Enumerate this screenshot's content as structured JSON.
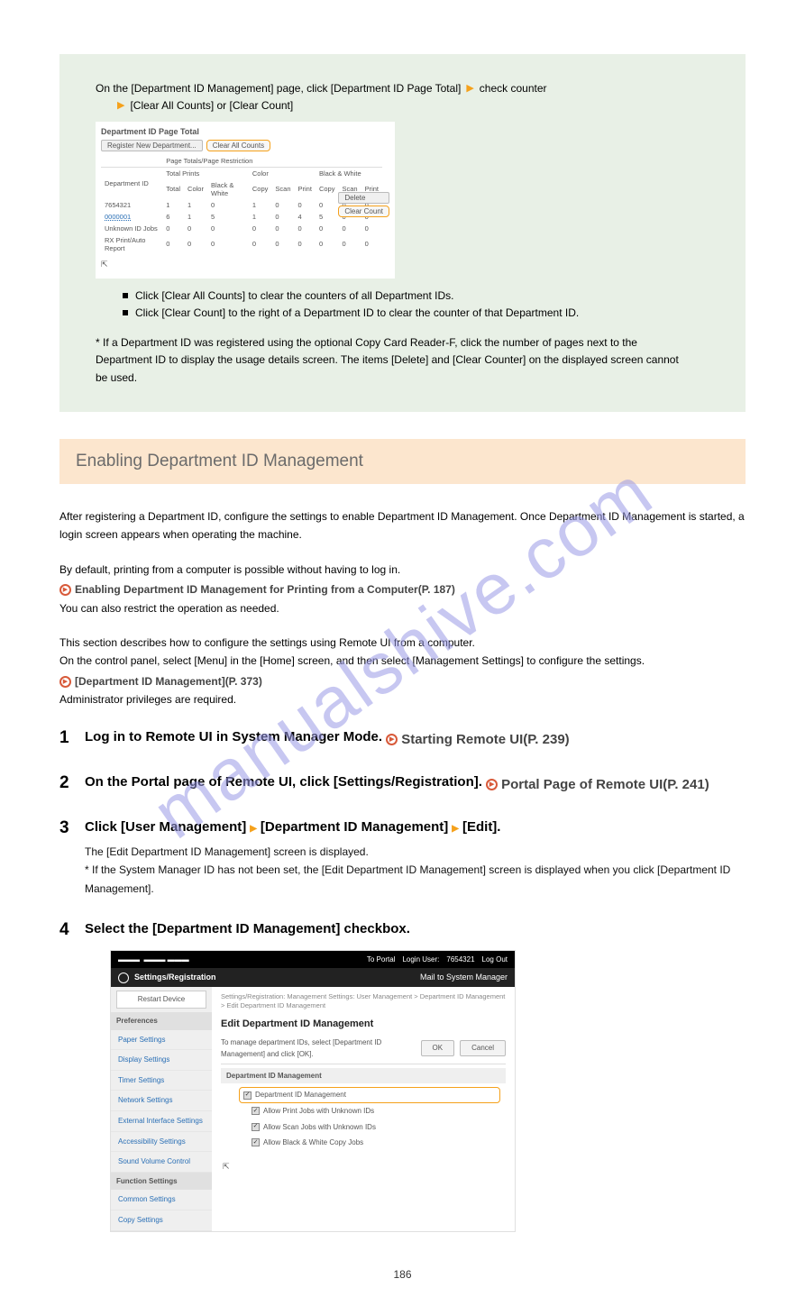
{
  "watermark": "manualshive.com",
  "green": {
    "line1_pre": "On the [Department ID Management] page, click [Department ID Page Total]",
    "line1_post": " check counter",
    "line2_pre": "",
    "line2_post": " [Clear All Counts] or [Clear Count]",
    "shot": {
      "title": "Department ID Page Total",
      "btn_register": "Register New Department...",
      "btn_clearall": "Clear All Counts",
      "hdr_pagetotals": "Page Totals/Page Restriction",
      "hdr_deptid": "Department ID",
      "hdr_totalprints": "Total Prints",
      "hdr_color": "Color",
      "hdr_bw": "Black & White",
      "sub_total": "Total",
      "sub_color": "Color",
      "sub_bw": "Black & White",
      "sub_copy": "Copy",
      "sub_scan": "Scan",
      "sub_print": "Print",
      "rows": [
        {
          "id": "7654321",
          "v": [
            "1",
            "1",
            "0",
            "1",
            "0",
            "0",
            "0",
            "0",
            "0"
          ]
        },
        {
          "id": "0000001",
          "v": [
            "6",
            "1",
            "5",
            "1",
            "0",
            "4",
            "5",
            "0",
            "0"
          ]
        },
        {
          "id": "Unknown ID Jobs",
          "v": [
            "0",
            "0",
            "0",
            "0",
            "0",
            "0",
            "0",
            "0",
            "0"
          ]
        },
        {
          "id": "RX Print/Auto Report",
          "v": [
            "0",
            "0",
            "0",
            "0",
            "0",
            "0",
            "0",
            "0",
            "0"
          ]
        }
      ],
      "btn_delete": "Delete",
      "btn_clearcount": "Clear Count"
    },
    "bullets": [
      "Click [Clear All Counts] to clear the counters of all Department IDs.",
      "Click [Clear Count] to the right of a Department ID to clear the counter of that Department ID."
    ],
    "note": "* If a Department ID was registered using the optional Copy Card Reader-F, click the number of pages next to the Department ID to display the usage details screen. The items [Delete] and [Clear Counter] on the displayed screen cannot be used."
  },
  "orange_title": "Enabling Department ID Management",
  "body": {
    "p1": "After registering a Department ID, configure the settings to enable Department ID Management. Once Department ID Management is started, a login screen appears when operating the machine.",
    "p2_pre": "By default, printing from a computer is possible without having to log in. ",
    "p2_link": "Enabling Department ID Management for Printing from a Computer(P. 187)",
    "p3": "You can also restrict the operation as needed.",
    "p4_pre": "This section describes how to configure the settings using Remote UI from a computer.",
    "p4_mid": "On the control panel, select [Menu] in the [Home] screen, and then select [Management Settings] to configure the settings. ",
    "p4_link": "[Department ID Management](P. 373)",
    "p5": "Administrator privileges are required."
  },
  "steps": [
    {
      "t": "Log in to Remote UI in System Manager Mode. ",
      "link": "Starting Remote UI(P. 239)"
    },
    {
      "t": "On the Portal page of Remote UI, click [Settings/Registration]. ",
      "link": "Portal Page of Remote UI(P. 241)"
    },
    {
      "t_html": "Click [User Management] {TRI} [Department ID Management] {TRI} [Edit].",
      "sub": "The [Edit Department ID Management] screen is displayed.",
      "note": "* If the System Manager ID has not been set, the [Edit Department ID Management] screen is displayed when you click [Department ID Management]."
    },
    {
      "t": "Select the [Department ID Management] checkbox."
    }
  ],
  "shot2": {
    "top_portal": "To Portal",
    "top_login": "Login User:",
    "top_user": "7654321",
    "top_logout": "Log Out",
    "sub_title": "Settings/Registration",
    "sub_mail": "Mail to System Manager",
    "restart": "Restart Device",
    "left_hdr1": "Preferences",
    "left_items1": [
      "Paper Settings",
      "Display Settings",
      "Timer Settings",
      "Network Settings",
      "External Interface Settings",
      "Accessibility Settings",
      "Sound Volume Control"
    ],
    "left_hdr2": "Function Settings",
    "left_items2": [
      "Common Settings",
      "Copy Settings"
    ],
    "crumb": "Settings/Registration: Management Settings: User Management > Department ID Management > Edit Department ID Management",
    "h": "Edit Department ID Management",
    "row_text": "To manage department IDs, select [Department ID Management] and click [OK].",
    "btn_ok": "OK",
    "btn_cancel": "Cancel",
    "section": "Department ID Management",
    "opt_main": "Department ID Management",
    "opts": [
      "Allow Print Jobs with Unknown IDs",
      "Allow Scan Jobs with Unknown IDs",
      "Allow Black & White Copy Jobs"
    ]
  },
  "pagenum": "186"
}
